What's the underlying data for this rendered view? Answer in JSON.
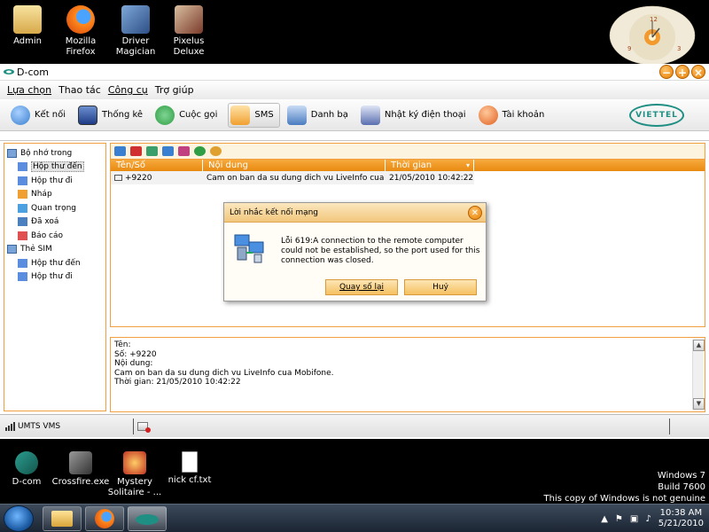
{
  "desktop": {
    "top_icons": [
      {
        "label": "Admin",
        "icon": "user-folder-icon"
      },
      {
        "label": "Mozilla Firefox",
        "icon": "firefox-icon"
      },
      {
        "label": "Driver Magician",
        "icon": "driver-magician-icon"
      },
      {
        "label": "Pixelus Deluxe",
        "icon": "pixelus-icon"
      }
    ],
    "bottom_icons": [
      {
        "label": "D-com",
        "icon": "dcom-icon"
      },
      {
        "label": "Crossfire.exe",
        "icon": "crossfire-icon"
      },
      {
        "label": "Mystery Solitaire - ...",
        "icon": "solitaire-icon"
      },
      {
        "label": "nick cf.txt",
        "icon": "text-file-icon"
      }
    ],
    "watermark": {
      "line1": "Windows 7",
      "line2": "Build 7600",
      "line3": "This copy of Windows is not genuine"
    },
    "clock_gadget": {
      "numbers": [
        "12",
        "9",
        "3"
      ]
    }
  },
  "app": {
    "title": "D-com",
    "window_buttons": [
      "−",
      "+",
      "×"
    ],
    "menu": [
      "Lựa chọn",
      "Thao tác",
      "Công cụ",
      "Trợ giúp"
    ],
    "toolbar": [
      {
        "label": "Kết nối",
        "icon": "connect-icon",
        "color": "#3a7fd0"
      },
      {
        "label": "Thống kê",
        "icon": "statistics-icon",
        "color": "#2a4fa0"
      },
      {
        "label": "Cuộc gọi",
        "icon": "phone-icon",
        "color": "#2f9e44"
      },
      {
        "label": "SMS",
        "icon": "envelope-icon",
        "color": "#f0a030"
      },
      {
        "label": "Danh bạ",
        "icon": "contacts-icon",
        "color": "#4a7cc0"
      },
      {
        "label": "Nhật ký điện thoại",
        "icon": "call-log-icon",
        "color": "#5a6fb0"
      },
      {
        "label": "Tài khoản",
        "icon": "account-icon",
        "color": "#e06020"
      }
    ],
    "brand": "VIETTEL",
    "tree": [
      {
        "label": "Bộ nhớ trong",
        "level": 1,
        "icon": "folder-icon"
      },
      {
        "label": "Hộp thư đến",
        "level": 2,
        "icon": "inbox-icon",
        "selected": true
      },
      {
        "label": "Hộp thư đi",
        "level": 2,
        "icon": "outbox-icon"
      },
      {
        "label": "Nháp",
        "level": 2,
        "icon": "draft-icon"
      },
      {
        "label": "Quan trọng",
        "level": 2,
        "icon": "important-icon"
      },
      {
        "label": "Đã xoá",
        "level": 2,
        "icon": "trash-icon"
      },
      {
        "label": "Báo cáo",
        "level": 2,
        "icon": "report-icon"
      },
      {
        "label": "Thẻ SIM",
        "level": 1,
        "icon": "folder-icon"
      },
      {
        "label": "Hộp thư đến",
        "level": 2,
        "icon": "inbox-icon"
      },
      {
        "label": "Hộp thư đi",
        "level": 2,
        "icon": "outbox-icon"
      }
    ],
    "message_toolbar": [
      "new-message-icon",
      "delete-message-icon",
      "forward-icon",
      "reply-icon",
      "move-icon",
      "call-icon",
      "search-icon"
    ],
    "list": {
      "columns": [
        "Tên/Số",
        "Nội dung",
        "Thời gian"
      ],
      "rows": [
        {
          "name": "+9220",
          "content": "Cam on ban da su dung dich vu LiveInfo cua Mobi...",
          "time": "21/05/2010 10:42:22"
        }
      ]
    },
    "detail": {
      "name_label": "Tên:",
      "number_line": "Số: +9220",
      "content_label": "Nội dung:",
      "content": "Cam on ban da su dung dich vu LiveInfo cua Mobifone.",
      "time_line": "Thời gian: 21/05/2010 10:42:22"
    },
    "status": {
      "network": "UMTS VMS"
    },
    "dialog": {
      "title": "Lời nhắc kết nối mạng",
      "message": "Lỗi 619:A connection to the remote computer could not be established, so the port used for this connection was closed.",
      "retry_label": "Quay số lại",
      "cancel_label": "Huỷ"
    }
  },
  "taskbar": {
    "time": "10:38 AM",
    "date": "5/21/2010"
  }
}
